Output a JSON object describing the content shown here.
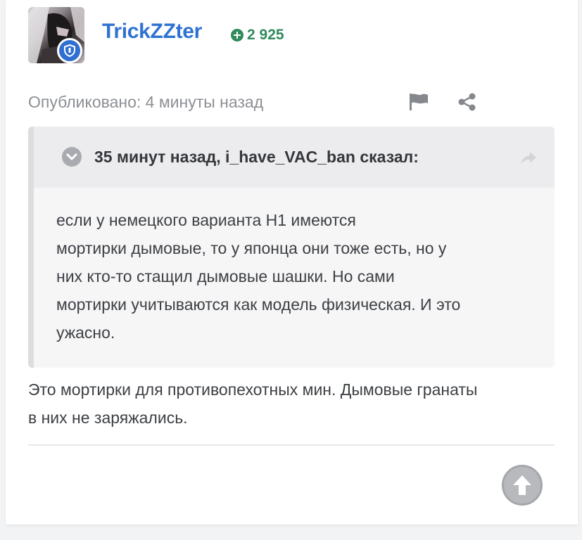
{
  "post": {
    "author": {
      "username": "TrickZZter",
      "reputation": "2 925",
      "avatar_icon": "user-avatar",
      "badge_icon": "shield-icon"
    },
    "published": "Опубликовано: 4 минуты назад",
    "quote": {
      "title": "35 минут назад, i_have_VAC_ban сказал:",
      "text_lines": [
        "если у немецкого варианта Н1 имеются",
        "мортирки дымовые, то у японца они тоже есть, но у",
        "них кто-то стащил дымовые шашки. Но сами",
        "мортирки учитываются как модель физическая. И это",
        "ужасно."
      ]
    },
    "body_lines": [
      "Это мортирки для противопехотных мин. Дымовые гранаты",
      "в них не заряжались."
    ]
  },
  "colors": {
    "username": "#2e72d2",
    "reputation": "#2f8a5c",
    "badge": "#2f6fd1",
    "muted_text": "#8c8f94",
    "body_text": "#3d4044"
  }
}
